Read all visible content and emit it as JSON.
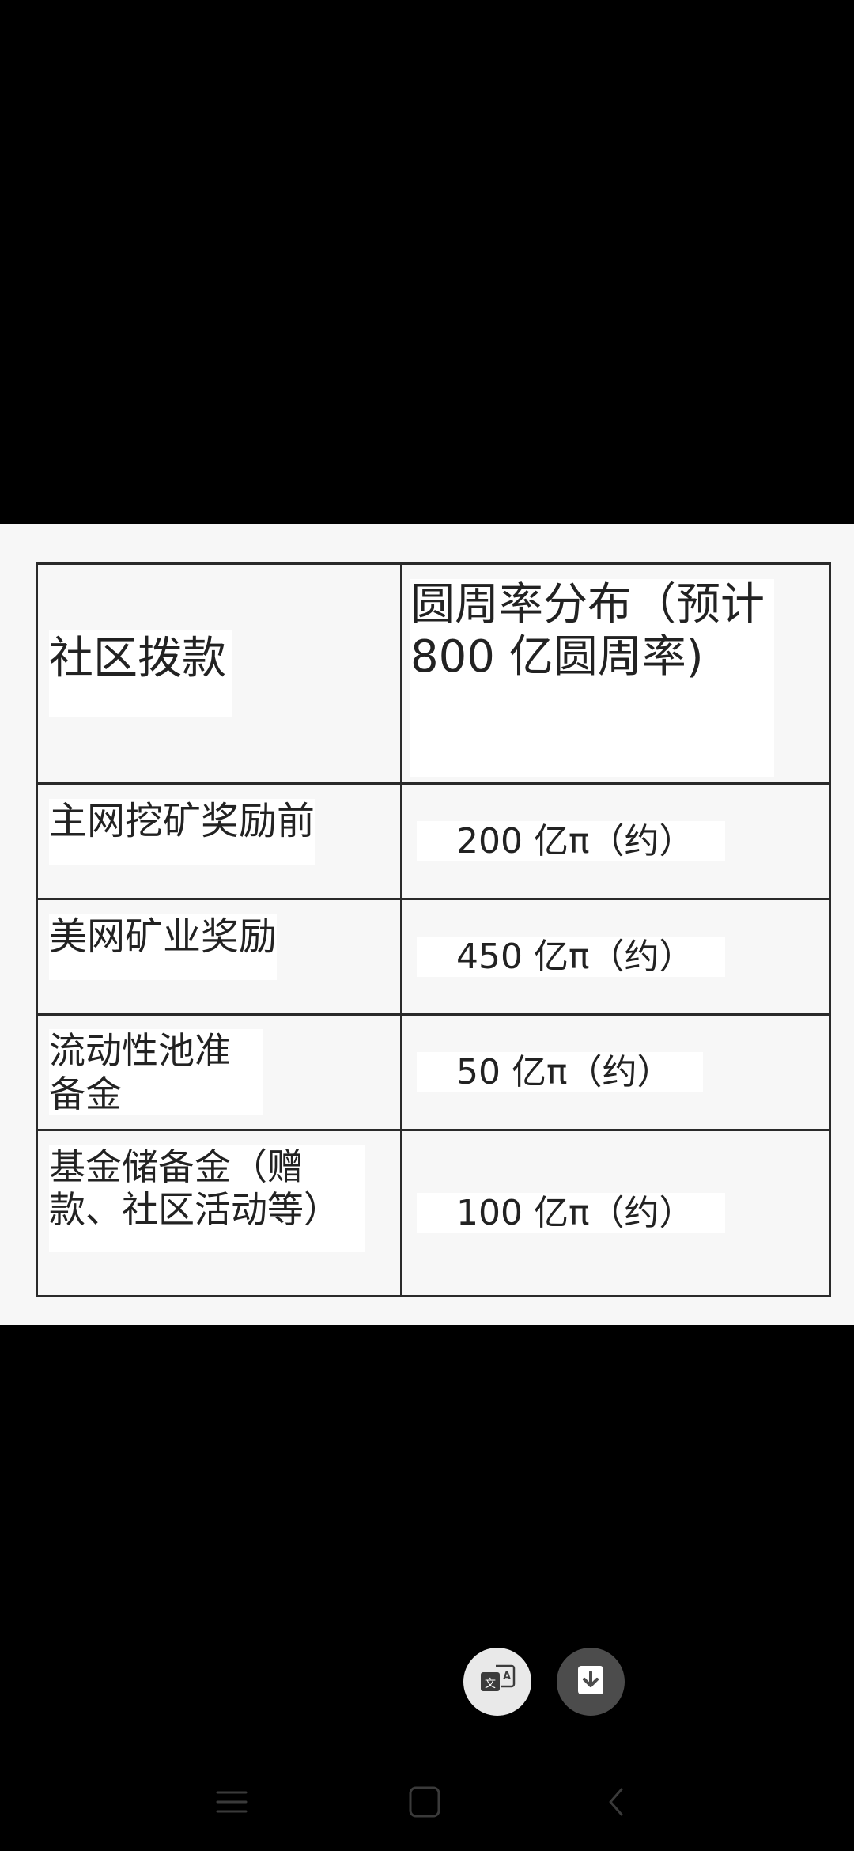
{
  "table": {
    "header": {
      "left": "社区拨款",
      "right": "圆周率分布（预计 800 亿圆周率)"
    },
    "rows": [
      {
        "label": "主网挖矿奖励前",
        "value": "200 亿π（约）"
      },
      {
        "label": "美网矿业奖励",
        "value": "450 亿π（约）"
      },
      {
        "label": "流动性池准备金",
        "value": "50 亿π（约）"
      },
      {
        "label": "基金储备金（赠款、社区活动等）",
        "value": "100 亿π（约）"
      }
    ]
  },
  "actions": {
    "translate_icon": "translate-icon",
    "download_icon": "download-icon"
  },
  "navigation": {
    "menu_icon": "menu-icon",
    "home_icon": "home-icon",
    "back_icon": "back-icon"
  },
  "colors": {
    "background": "#000000",
    "image_panel": "#f7f7f7",
    "border": "#2a2a2a",
    "text": "#222222",
    "translate_fab": "#e9e9e9",
    "download_fab": "#4c4c4c",
    "nav_icon": "#3a3a3a"
  }
}
